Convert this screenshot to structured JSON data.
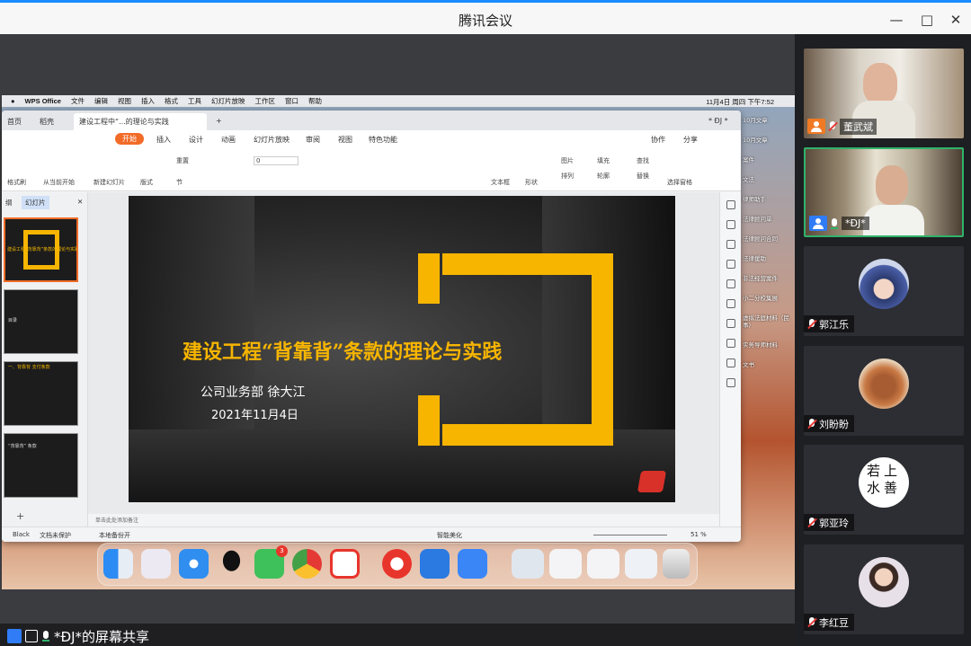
{
  "window": {
    "title": "腾讯会议"
  },
  "share": {
    "label": "*ĐJ*的屏幕共享"
  },
  "mac_menu": {
    "app": "WPS Office",
    "items": [
      "文件",
      "编辑",
      "视图",
      "插入",
      "格式",
      "工具",
      "幻灯片放映",
      "工作区",
      "窗口",
      "帮助"
    ],
    "clock": "11月4日 周四 下午7:52"
  },
  "wps": {
    "tabs": [
      "首页",
      "稻壳",
      "建设工程中“...的理论与实践"
    ],
    "user": "* ĐJ *",
    "ribbon_tabs": [
      "开始",
      "插入",
      "设计",
      "动画",
      "幻灯片放映",
      "审阅",
      "视图",
      "特色功能"
    ],
    "ribbon_right": [
      "协作",
      "分享"
    ],
    "ribbon": {
      "format_brush": "格式刷",
      "from_current": "从当前开始",
      "new_slide": "新建幻灯片",
      "layout": "版式",
      "reset": "重置",
      "section": "节",
      "font_size": "0",
      "textbox": "文本框",
      "shape": "形状",
      "picture": "图片",
      "arrange": "排列",
      "fill": "填充",
      "outline": "轮廓",
      "find": "查找",
      "replace": "替换",
      "select_pane": "选择窗格"
    },
    "panel_tabs": [
      "纲",
      "幻灯片"
    ],
    "add_slide": "+",
    "notes_placeholder": "单击此处添加备注",
    "status": {
      "theme": "Black",
      "protect": "文档未保护",
      "backup": "本地备份开",
      "beautify": "智能美化",
      "zoom": "51 %"
    },
    "thumbs": [
      {
        "title": "建设工程“背靠背”条款的理论与实践"
      },
      {
        "title": "目录"
      },
      {
        "title": "一、背靠背 支付条款"
      },
      {
        "title": "“背靠背” 条款"
      }
    ]
  },
  "slide": {
    "title": "建设工程“背靠背”条款的理论与实践",
    "subtitle": "公司业务部   徐大江",
    "date": "2021年11月4日"
  },
  "desktop_files": [
    "10月文章",
    "10月文章",
    "案件",
    "文法",
    "律师助手",
    "法律顾问单",
    "法律顾问合同",
    "法律援助",
    "非法经营案件",
    "小二分校集展",
    "虚拟法庭材料（民事）",
    "实务导师材料",
    "文书"
  ],
  "dock": {
    "apps": [
      "finder-icon",
      "launchpad-icon",
      "safari-icon",
      "qq-icon",
      "wechat-icon",
      "chrome-icon",
      "wps-icon",
      "netease-music-icon",
      "doc-app-icon",
      "lark-icon"
    ],
    "wechat_badge": "3"
  },
  "participants": [
    {
      "name": "董武斌",
      "kind": "video",
      "mic": "muted",
      "icon_color": "#f07a23"
    },
    {
      "name": "*ĐJ*",
      "kind": "video",
      "mic": "on",
      "icon_color": "#2f7cf6",
      "active": true
    },
    {
      "name": "郭江乐",
      "kind": "avatar",
      "mic": "muted"
    },
    {
      "name": "刘盼盼",
      "kind": "avatar",
      "mic": "muted"
    },
    {
      "name": "郭亚玲",
      "kind": "seal",
      "mic": "muted",
      "seal_text": "若上水善"
    },
    {
      "name": "李红豆",
      "kind": "avatar",
      "mic": "muted"
    }
  ],
  "colors": {
    "accent": "#f7b500",
    "wps_orange": "#f26b27",
    "active_border": "#2fb36a"
  }
}
